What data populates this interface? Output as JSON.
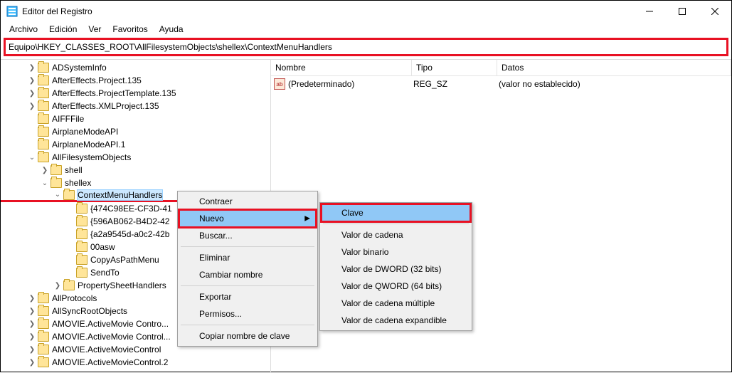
{
  "window": {
    "title": "Editor del Registro"
  },
  "menubar": {
    "file": "Archivo",
    "edit": "Edición",
    "view": "Ver",
    "favorites": "Favoritos",
    "help": "Ayuda"
  },
  "address": "Equipo\\HKEY_CLASSES_ROOT\\AllFilesystemObjects\\shellex\\ContextMenuHandlers",
  "tree": {
    "n0": "ADSystemInfo",
    "n1": "AfterEffects.Project.135",
    "n2": "AfterEffects.ProjectTemplate.135",
    "n3": "AfterEffects.XMLProject.135",
    "n4": "AIFFFile",
    "n5": "AirplaneModeAPI",
    "n6": "AirplaneModeAPI.1",
    "n7": "AllFilesystemObjects",
    "n8": "shell",
    "n9": "shellex",
    "n10": "ContextMenuHandlers",
    "n11": "{474C98EE-CF3D-41",
    "n12": "{596AB062-B4D2-42",
    "n13": "{a2a9545d-a0c2-42b",
    "n14": "00asw",
    "n15": "CopyAsPathMenu",
    "n16": "SendTo",
    "n17": "PropertySheetHandlers",
    "n18": "AllProtocols",
    "n19": "AllSyncRootObjects",
    "n20": "AMOVIE.ActiveMovie Contro...",
    "n21": "AMOVIE.ActiveMovie Control...",
    "n22": "AMOVIE.ActiveMovieControl",
    "n23": "AMOVIE.ActiveMovieControl.2"
  },
  "list": {
    "cols": {
      "name": "Nombre",
      "type": "Tipo",
      "data": "Datos"
    },
    "row0": {
      "name": "(Predeterminado)",
      "type": "REG_SZ",
      "data": "(valor no establecido)"
    }
  },
  "menu1": {
    "collapse": "Contraer",
    "new": "Nuevo",
    "find": "Buscar...",
    "delete": "Eliminar",
    "rename": "Cambiar nombre",
    "export": "Exportar",
    "permissions": "Permisos...",
    "copykey": "Copiar nombre de clave"
  },
  "menu2": {
    "key": "Clave",
    "string": "Valor de cadena",
    "binary": "Valor binario",
    "dword": "Valor de DWORD (32 bits)",
    "qword": "Valor de QWORD (64 bits)",
    "multi": "Valor de cadena múltiple",
    "expand": "Valor de cadena expandible"
  }
}
